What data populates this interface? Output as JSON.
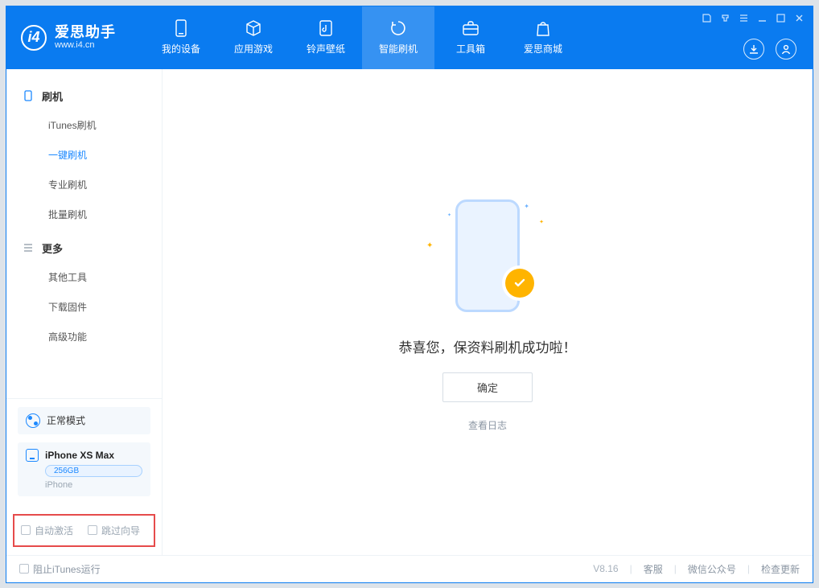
{
  "app": {
    "name_cn": "爱思助手",
    "name_en": "www.i4.cn"
  },
  "nav": {
    "tabs": [
      {
        "label": "我的设备"
      },
      {
        "label": "应用游戏"
      },
      {
        "label": "铃声壁纸"
      },
      {
        "label": "智能刷机"
      },
      {
        "label": "工具箱"
      },
      {
        "label": "爱思商城"
      }
    ]
  },
  "sidebar": {
    "group1": {
      "title": "刷机",
      "items": [
        {
          "label": "iTunes刷机"
        },
        {
          "label": "一键刷机"
        },
        {
          "label": "专业刷机"
        },
        {
          "label": "批量刷机"
        }
      ]
    },
    "group2": {
      "title": "更多",
      "items": [
        {
          "label": "其他工具"
        },
        {
          "label": "下载固件"
        },
        {
          "label": "高级功能"
        }
      ]
    },
    "mode": {
      "label": "正常模式"
    },
    "device": {
      "name": "iPhone XS Max",
      "storage": "256GB",
      "type": "iPhone"
    },
    "checks": {
      "auto_activate": "自动激活",
      "skip_guide": "跳过向导"
    }
  },
  "main": {
    "success": "恭喜您，保资料刷机成功啦！",
    "ok": "确定",
    "view_log": "查看日志"
  },
  "status": {
    "block_itunes": "阻止iTunes运行",
    "version": "V8.16",
    "support": "客服",
    "wechat": "微信公众号",
    "update": "检查更新"
  }
}
